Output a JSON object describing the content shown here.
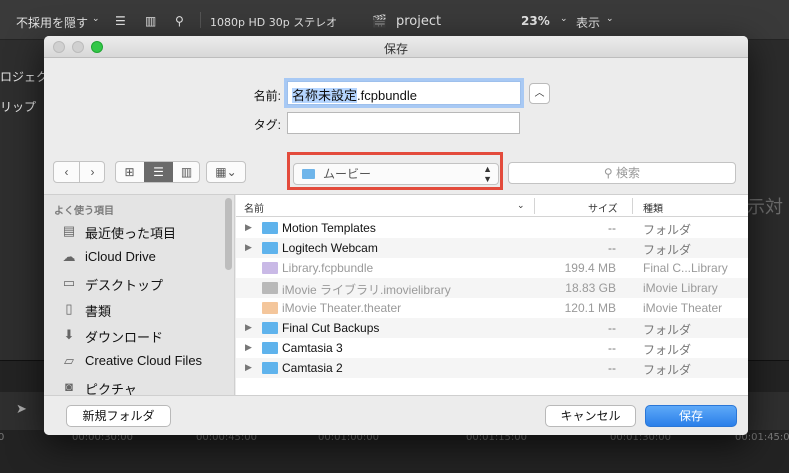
{
  "fcp": {
    "filter_label": "不採用を隠す",
    "format_label": "1080p HD 30p ステレオ",
    "project_name": "project",
    "zoom": "23%",
    "view_label": "表示",
    "left_labels": [
      "ロジェク",
      "リップ"
    ],
    "right_text": "示対",
    "ruler_marks": [
      "00:00:30:00",
      "00:00:45:00",
      "00:01:00:00",
      "00:01:15:00",
      "00:01:30:00",
      "00:01:45:00"
    ]
  },
  "dialog": {
    "title": "保存",
    "name_label": "名前:",
    "name_selected": "名称未設定",
    "name_ext": ".fcpbundle",
    "tag_label": "タグ:",
    "location": "ムービー",
    "search_placeholder": "検索",
    "sidebar": {
      "header": "よく使う項目",
      "items": [
        {
          "icon": "recents-icon",
          "label": "最近使った項目"
        },
        {
          "icon": "cloud-icon",
          "label": "iCloud Drive"
        },
        {
          "icon": "desktop-icon",
          "label": "デスクトップ"
        },
        {
          "icon": "documents-icon",
          "label": "書類"
        },
        {
          "icon": "download-icon",
          "label": "ダウンロード"
        },
        {
          "icon": "folder-icon",
          "label": "Creative Cloud Files"
        },
        {
          "icon": "camera-icon",
          "label": "ピクチャ"
        }
      ]
    },
    "columns": {
      "name": "名前",
      "size": "サイズ",
      "kind": "種類"
    },
    "files": [
      {
        "name": "Motion Templates",
        "size": "--",
        "kind": "フォルダ",
        "type": "folder",
        "enabled": true
      },
      {
        "name": "Logitech Webcam",
        "size": "--",
        "kind": "フォルダ",
        "type": "folder",
        "enabled": true
      },
      {
        "name": "Library.fcpbundle",
        "size": "199.4 MB",
        "kind": "Final C...Library",
        "type": "bundle",
        "enabled": false
      },
      {
        "name": "iMovie ライブラリ.imovielibrary",
        "size": "18.83 GB",
        "kind": "iMovie Library",
        "type": "library",
        "enabled": false
      },
      {
        "name": "iMovie Theater.theater",
        "size": "120.1 MB",
        "kind": "iMovie Theater",
        "type": "theater",
        "enabled": false
      },
      {
        "name": "Final Cut Backups",
        "size": "--",
        "kind": "フォルダ",
        "type": "folder",
        "enabled": true
      },
      {
        "name": "Camtasia 3",
        "size": "--",
        "kind": "フォルダ",
        "type": "folder",
        "enabled": true
      },
      {
        "name": "Camtasia 2",
        "size": "--",
        "kind": "フォルダ",
        "type": "folder",
        "enabled": true
      }
    ],
    "new_folder_button": "新規フォルダ",
    "cancel_button": "キャンセル",
    "save_button": "保存"
  }
}
